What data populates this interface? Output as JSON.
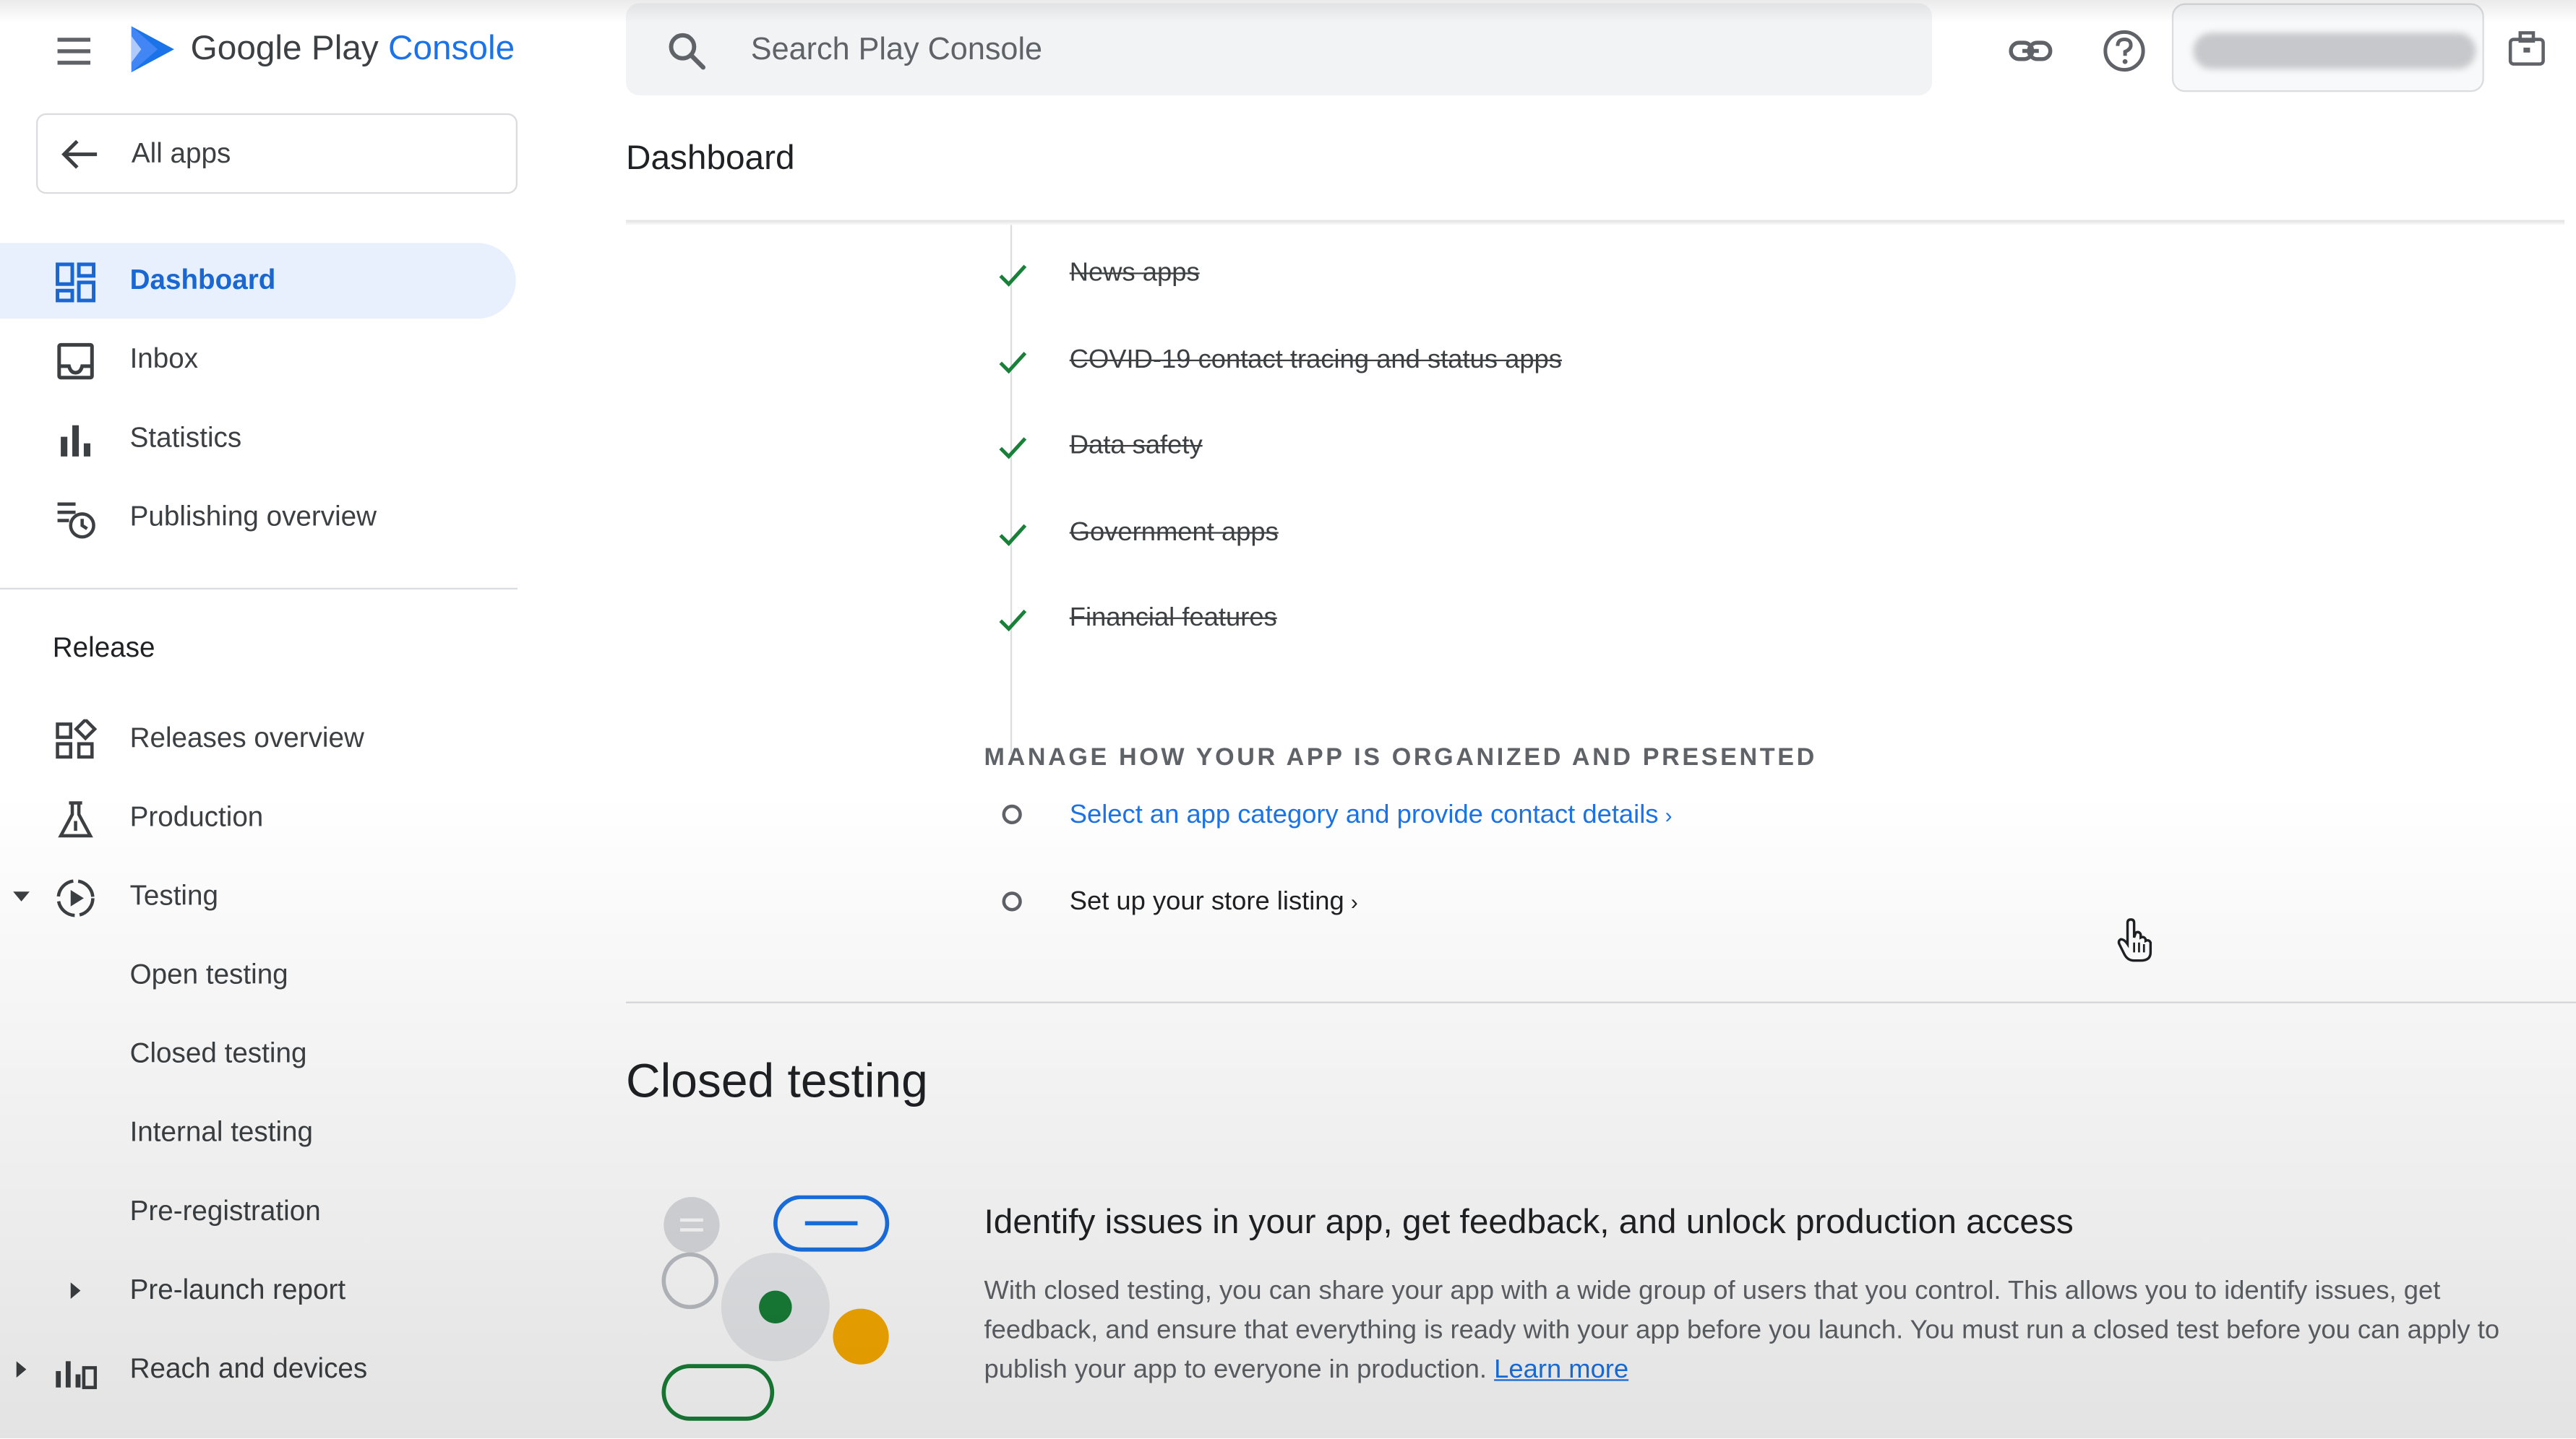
{
  "app": {
    "name_prefix": "Google Play",
    "name_suffix": "Console",
    "brand_color": "#1a73e8"
  },
  "search": {
    "placeholder": "Search Play Console"
  },
  "topbar_icons": [
    "link-icon",
    "help-icon",
    "briefcase-icon"
  ],
  "sidebar": {
    "all_apps_label": "All apps",
    "items": [
      {
        "label": "Dashboard",
        "icon": "dashboard-icon",
        "active": true
      },
      {
        "label": "Inbox",
        "icon": "inbox-icon"
      },
      {
        "label": "Statistics",
        "icon": "bar-chart-icon"
      },
      {
        "label": "Publishing overview",
        "icon": "publishing-overview-icon"
      }
    ],
    "section_release": "Release",
    "release_items": [
      {
        "label": "Releases overview",
        "icon": "releases-overview-icon"
      },
      {
        "label": "Production",
        "icon": "production-icon"
      },
      {
        "label": "Testing",
        "icon": "testing-icon",
        "expanded": true
      },
      {
        "label": "Open testing"
      },
      {
        "label": "Closed testing"
      },
      {
        "label": "Internal testing"
      },
      {
        "label": "Pre-registration"
      },
      {
        "label": "Pre-launch report",
        "collapsed": true
      },
      {
        "label": "Reach and devices",
        "icon": "reach-devices-icon",
        "collapsed": true
      }
    ]
  },
  "main": {
    "page_title": "Dashboard",
    "completed_tasks": [
      "News apps",
      "COVID-19 contact tracing and status apps",
      "Data safety",
      "Government apps",
      "Financial features"
    ],
    "manage_heading": "MANAGE HOW YOUR APP IS ORGANIZED AND PRESENTED",
    "pending_tasks": [
      "Select an app category and provide contact details",
      "Set up your store listing"
    ],
    "closed_testing": {
      "title": "Closed testing",
      "heading": "Identify issues in your app, get feedback, and unlock production access",
      "body": "With closed testing, you can share your app with a wide group of users that you control. This allows you to identify issues, get feedback, and ensure that everything is ready with your app before you launch. You must run a closed test before you can apply to publish your app to everyone in production.",
      "learn_more": "Learn more"
    }
  }
}
